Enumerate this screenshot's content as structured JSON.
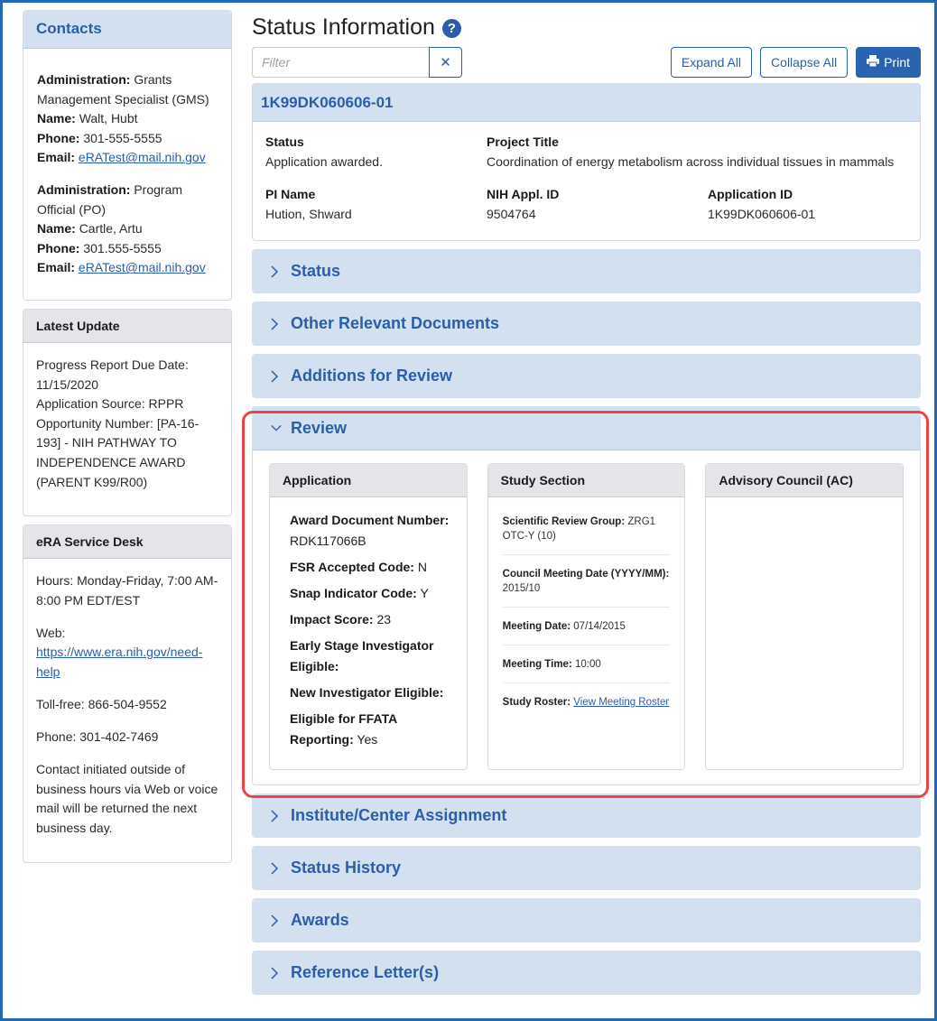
{
  "sidebar": {
    "contacts": {
      "title": "Contacts",
      "blocks": [
        {
          "administration_label": "Administration:",
          "administration": "Grants Management Specialist (GMS)",
          "name_label": "Name:",
          "name": "Walt, Hubt",
          "phone_label": "Phone:",
          "phone": "301-555-5555",
          "email_label": "Email:",
          "email": "eRATest@mail.nih.gov"
        },
        {
          "administration_label": "Administration:",
          "administration": "Program Official (PO)",
          "name_label": "Name:",
          "name": "Cartle, Artu",
          "phone_label": "Phone:",
          "phone": "301.555-5555",
          "email_label": "Email:",
          "email": "eRATest@mail.nih.gov"
        }
      ]
    },
    "latest_update": {
      "title": "Latest Update",
      "lines": [
        "Progress Report Due Date: 11/15/2020",
        "Application Source: RPPR",
        "Opportunity Number: [PA-16-193] -  NIH PATHWAY TO INDEPENDENCE AWARD (PARENT K99/R00)"
      ]
    },
    "service_desk": {
      "title": "eRA Service Desk",
      "hours": "Hours: Monday-Friday, 7:00 AM-8:00 PM EDT/EST",
      "web_label": "Web:",
      "web_link": "https://www.era.nih.gov/need-help",
      "toll_free": "Toll-free: 866-504-9552",
      "phone": "Phone: 301-402-7469",
      "note": "Contact initiated outside of business hours via Web or voice mail will be returned the next business day."
    }
  },
  "main": {
    "title": "Status Information",
    "help_icon": "question-circle-icon",
    "filter": {
      "placeholder": "Filter",
      "value": "",
      "clear_icon": "close-icon"
    },
    "buttons": {
      "expand_all": "Expand All",
      "collapse_all": "Collapse All",
      "print": "Print",
      "print_icon": "printer-icon"
    },
    "application": {
      "id_header": "1K99DK060606-01",
      "fields": {
        "status_label": "Status",
        "status": "Application awarded.",
        "project_title_label": "Project Title",
        "project_title": "Coordination of energy metabolism across individual tissues in mammals",
        "pi_name_label": "PI Name",
        "pi_name": "Hution, Shward",
        "nih_appl_id_label": "NIH Appl. ID",
        "nih_appl_id": "9504764",
        "application_id_label": "Application ID",
        "application_id": "1K99DK060606-01"
      }
    },
    "sections_before": [
      {
        "label": "Status",
        "expanded": false
      },
      {
        "label": "Other Relevant Documents",
        "expanded": false
      },
      {
        "label": "Additions for Review",
        "expanded": false
      }
    ],
    "review": {
      "label": "Review",
      "expanded": true,
      "application_card": {
        "title": "Application",
        "rows": [
          {
            "label": "Award Document Number:",
            "value": "RDK117066B"
          },
          {
            "label": "FSR Accepted Code:",
            "value": "N"
          },
          {
            "label": "Snap Indicator Code:",
            "value": "Y"
          },
          {
            "label": "Impact Score:",
            "value": "23"
          },
          {
            "label": "Early Stage Investigator Eligible:",
            "value": ""
          },
          {
            "label": "New Investigator Eligible:",
            "value": ""
          },
          {
            "label": "Eligible for FFATA Reporting:",
            "value": "Yes"
          }
        ]
      },
      "study_section_card": {
        "title": "Study Section",
        "rows": [
          {
            "label": "Scientific Review Group:",
            "value": "ZRG1 OTC-Y (10)"
          },
          {
            "label": "Council Meeting Date (YYYY/MM):",
            "value": "2015/10"
          },
          {
            "label": "Meeting Date:",
            "value": "07/14/2015"
          },
          {
            "label": "Meeting Time:",
            "value": "10:00"
          },
          {
            "label": "Study Roster:",
            "link": "View Meeting Roster"
          }
        ]
      },
      "advisory_card": {
        "title": "Advisory Council (AC)"
      }
    },
    "sections_after": [
      {
        "label": "Institute/Center Assignment",
        "expanded": false
      },
      {
        "label": "Status History",
        "expanded": false
      },
      {
        "label": "Awards",
        "expanded": false
      },
      {
        "label": "Reference Letter(s)",
        "expanded": false
      }
    ]
  },
  "colors": {
    "accent": "#2a5ea8",
    "panel_header": "#d3e0ef",
    "card_header": "#e3e5e8",
    "highlight": "#ef4246",
    "frame": "#2269b3"
  }
}
